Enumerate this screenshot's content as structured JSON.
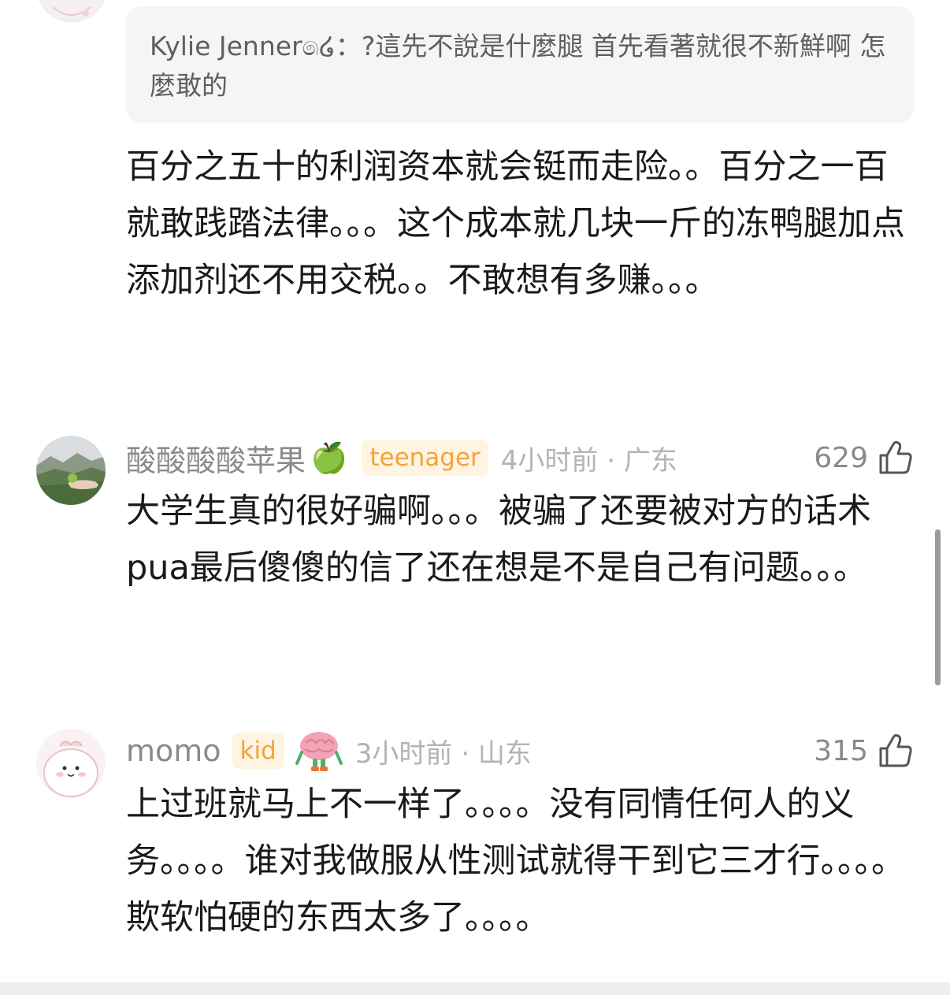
{
  "quote": {
    "text": "Kylie Jenner෧໒：?這先不說是什麼腿 首先看著就很不新鮮啊 怎麼敢的"
  },
  "reply": {
    "text": "百分之五十的利润资本就会铤而走险。。百分之一百就敢践踏法律。。。这个成本就几块一斤的冻鸭腿加点添加剂还不用交税。。不敢想有多赚。。。"
  },
  "comments": [
    {
      "username": "酸酸酸酸苹果",
      "emoji": "🍏",
      "badge": "teenager",
      "meta": "4小时前 · 广东",
      "likes": "629",
      "text": "大学生真的很好骗啊。。。被骗了还要被对方的话术pua最后傻傻的信了还在想是不是自己有问题。。。"
    },
    {
      "username": "momo",
      "badge": "kid",
      "meta": "3小时前 · 山东",
      "likes": "315",
      "text": "上过班就马上不一样了。。。。没有同情任何人的义务。。。。谁对我做服从性测试就得干到它三才行。。。。欺软怕硬的东西太多了。。。。"
    }
  ],
  "icons": {
    "like": "thumbs-up-icon",
    "emoji_badge": "brain-character-icon"
  },
  "colors": {
    "badge_text": "#f2a43a",
    "badge_bg": "#fff4e2",
    "quote_bg": "#f5f5f5"
  }
}
